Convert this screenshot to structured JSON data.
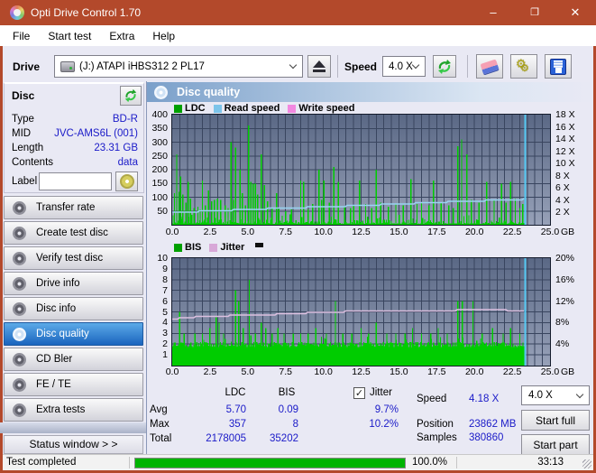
{
  "theme": {
    "titlebar": "#B3492B",
    "value_text": "#1A1AC8",
    "nav_selected": "#2F7FD0",
    "progress_green": "#00B400",
    "chart_bg_top": "#5A6885",
    "chart_bg_bottom": "#97A1B8"
  },
  "window": {
    "title": "Opti Drive Control 1.70",
    "controls": {
      "minimize": "–",
      "maximize": "❐",
      "close": "✕"
    }
  },
  "menu": {
    "items": [
      "File",
      "Start test",
      "Extra",
      "Help"
    ]
  },
  "toolbar": {
    "drive_label": "Drive",
    "drive_value": "(J:)   ATAPI iHBS312   2 PL17",
    "speed_label": "Speed",
    "speed_value": "4.0 X"
  },
  "disc_panel": {
    "title": "Disc",
    "fields": [
      {
        "label": "Type",
        "value": "BD-R"
      },
      {
        "label": "MID",
        "value": "JVC-AMS6L (001)"
      },
      {
        "label": "Length",
        "value": "23.31 GB"
      },
      {
        "label": "Contents",
        "value": "data"
      }
    ],
    "label_field": {
      "label": "Label",
      "value": ""
    }
  },
  "sidebar": {
    "items": [
      {
        "label": "Transfer rate",
        "selected": false
      },
      {
        "label": "Create test disc",
        "selected": false
      },
      {
        "label": "Verify test disc",
        "selected": false
      },
      {
        "label": "Drive info",
        "selected": false
      },
      {
        "label": "Disc info",
        "selected": false
      },
      {
        "label": "Disc quality",
        "selected": true
      },
      {
        "label": "CD Bler",
        "selected": false
      },
      {
        "label": "FE / TE",
        "selected": false
      },
      {
        "label": "Extra tests",
        "selected": false
      }
    ],
    "status_window_label": "Status window > >"
  },
  "main": {
    "header": "Disc quality"
  },
  "summary": {
    "col_headers": [
      "LDC",
      "BIS"
    ],
    "jitter_label": "Jitter",
    "jitter_checked": true,
    "rows": [
      {
        "label": "Avg",
        "ldc": "5.70",
        "bis": "0.09",
        "jitter": "9.7%"
      },
      {
        "label": "Max",
        "ldc": "357",
        "bis": "8",
        "jitter": "10.2%"
      },
      {
        "label": "Total",
        "ldc": "2178005",
        "bis": "35202",
        "jitter": ""
      }
    ],
    "info": [
      {
        "label": "Speed",
        "value": "4.18 X"
      },
      {
        "label": "Position",
        "value": "23862 MB"
      },
      {
        "label": "Samples",
        "value": "380860"
      }
    ],
    "speed_select": "4.0 X",
    "buttons": [
      "Start full",
      "Start part"
    ]
  },
  "statusbar": {
    "status": "Test completed",
    "progress_pct": "100.0%",
    "progress_value": 100,
    "elapsed": "33:13"
  },
  "chart_data": [
    {
      "type": "bar+line",
      "title": "LDC errors with read speed",
      "legend": [
        {
          "label": "LDC",
          "color": "#00A000"
        },
        {
          "label": "Read speed",
          "color": "#7CC4EA"
        },
        {
          "label": "Write speed",
          "color": "#F288E0"
        }
      ],
      "xlim": [
        0,
        25
      ],
      "x_unit": "GB",
      "x_ticks": [
        "0.0",
        "2.5",
        "5.0",
        "7.5",
        "10.0",
        "12.5",
        "15.0",
        "17.5",
        "20.0",
        "22.5",
        "25.0"
      ],
      "ylim_left": [
        0,
        400
      ],
      "y_ticks_left": [
        "400",
        "350",
        "300",
        "250",
        "200",
        "150",
        "100",
        "50"
      ],
      "ylim_right": [
        0,
        18
      ],
      "y_ticks_right": [
        "18 X",
        "16 X",
        "14 X",
        "12 X",
        "10 X",
        "8 X",
        "6 X",
        "4 X",
        "2 X"
      ],
      "bar_color": "#00CC00",
      "line_color": "#9AD4F2",
      "end_marker_color": "#55C8F2",
      "data_end_x": 23.35,
      "noise": {
        "max": 40,
        "base": 4,
        "step_gb": 0.065
      },
      "spikes": [
        [
          0.15,
          115
        ],
        [
          0.3,
          255
        ],
        [
          0.45,
          120
        ],
        [
          0.55,
          175
        ],
        [
          0.7,
          110
        ],
        [
          0.9,
          80
        ],
        [
          1.05,
          155
        ],
        [
          1.2,
          95
        ],
        [
          1.45,
          60
        ],
        [
          1.7,
          65
        ],
        [
          1.85,
          55
        ],
        [
          2.0,
          160
        ],
        [
          2.2,
          70
        ],
        [
          2.4,
          125
        ],
        [
          2.6,
          85
        ],
        [
          2.8,
          90
        ],
        [
          3.0,
          95
        ],
        [
          3.2,
          90
        ],
        [
          3.5,
          70
        ],
        [
          3.7,
          60
        ],
        [
          3.9,
          300
        ],
        [
          4.05,
          90
        ],
        [
          4.2,
          280
        ],
        [
          4.5,
          200
        ],
        [
          4.65,
          115
        ],
        [
          4.85,
          70
        ],
        [
          5.05,
          360
        ],
        [
          5.2,
          155
        ],
        [
          5.35,
          150
        ],
        [
          5.5,
          150
        ],
        [
          5.65,
          110
        ],
        [
          5.9,
          255
        ],
        [
          6.1,
          145
        ],
        [
          6.3,
          85
        ],
        [
          6.6,
          60
        ],
        [
          6.9,
          115
        ],
        [
          7.05,
          60
        ],
        [
          7.5,
          50
        ],
        [
          7.9,
          55
        ],
        [
          8.5,
          160
        ],
        [
          8.7,
          155
        ],
        [
          9.0,
          55
        ],
        [
          9.3,
          75
        ],
        [
          9.7,
          200
        ],
        [
          9.9,
          90
        ],
        [
          10.05,
          160
        ],
        [
          10.4,
          80
        ],
        [
          10.7,
          210
        ],
        [
          11.0,
          155
        ],
        [
          11.4,
          65
        ],
        [
          11.8,
          60
        ],
        [
          12.0,
          70
        ],
        [
          12.4,
          160
        ],
        [
          12.8,
          75
        ],
        [
          13.2,
          60
        ],
        [
          13.5,
          200
        ],
        [
          13.8,
          80
        ],
        [
          14.3,
          65
        ],
        [
          14.8,
          75
        ],
        [
          15.3,
          70
        ],
        [
          15.8,
          165
        ],
        [
          16.2,
          75
        ],
        [
          16.5,
          80
        ],
        [
          17.0,
          70
        ],
        [
          17.3,
          160
        ],
        [
          17.8,
          80
        ],
        [
          18.3,
          70
        ],
        [
          18.6,
          60
        ],
        [
          18.9,
          285
        ],
        [
          19.15,
          310
        ],
        [
          19.5,
          255
        ],
        [
          19.8,
          90
        ],
        [
          20.3,
          80
        ],
        [
          20.8,
          155
        ],
        [
          21.3,
          90
        ],
        [
          21.8,
          150
        ],
        [
          22.1,
          80
        ],
        [
          22.4,
          155
        ],
        [
          22.7,
          95
        ],
        [
          23.0,
          60
        ],
        [
          23.2,
          75
        ]
      ],
      "line_points_rightaxis": [
        [
          0,
          2.0
        ],
        [
          2,
          2.2
        ],
        [
          4,
          2.4
        ],
        [
          6,
          2.6
        ],
        [
          8,
          2.75
        ],
        [
          10,
          2.95
        ],
        [
          12,
          3.1
        ],
        [
          14,
          3.3
        ],
        [
          16,
          3.5
        ],
        [
          18,
          3.7
        ],
        [
          20,
          3.9
        ],
        [
          21.5,
          4.0
        ],
        [
          23.3,
          4.18
        ]
      ]
    },
    {
      "type": "bar+line",
      "title": "BIS errors with jitter",
      "legend": [
        {
          "label": "BIS",
          "color": "#00A000"
        },
        {
          "label": "Jitter",
          "color": "#D8A8D8"
        }
      ],
      "xlim": [
        0,
        25
      ],
      "x_unit": "GB",
      "x_ticks": [
        "0.0",
        "2.5",
        "5.0",
        "7.5",
        "10.0",
        "12.5",
        "15.0",
        "17.5",
        "20.0",
        "22.5",
        "25.0"
      ],
      "ylim_left": [
        0,
        10
      ],
      "y_ticks_left": [
        "10",
        "9",
        "8",
        "7",
        "6",
        "5",
        "4",
        "3",
        "2",
        "1"
      ],
      "ylim_right": [
        0,
        20
      ],
      "y_ticks_right": [
        "20%",
        "16%",
        "12%",
        "8%",
        "4%"
      ],
      "bar_color": "#00CC00",
      "line_color": "#DCC0E0",
      "end_marker_color": "#55C8F2",
      "data_end_x": 23.35,
      "noise": {
        "max": 2.2,
        "base": 1.7,
        "step_gb": 0.065
      },
      "spikes": [
        [
          0.5,
          5
        ],
        [
          0.8,
          3
        ],
        [
          1.5,
          3
        ],
        [
          2.0,
          3
        ],
        [
          2.5,
          3.5
        ],
        [
          2.9,
          4.5
        ],
        [
          3.1,
          4
        ],
        [
          3.4,
          3
        ],
        [
          4.2,
          7
        ],
        [
          4.4,
          6
        ],
        [
          4.7,
          3.5
        ],
        [
          5.1,
          8
        ],
        [
          5.5,
          3
        ],
        [
          5.9,
          4
        ],
        [
          6.2,
          3.5
        ],
        [
          6.6,
          3
        ],
        [
          7.0,
          3.5
        ],
        [
          7.4,
          3
        ],
        [
          8.0,
          3
        ],
        [
          8.5,
          3
        ],
        [
          9.0,
          3
        ],
        [
          9.5,
          3.5
        ],
        [
          10.2,
          3
        ],
        [
          10.8,
          6
        ],
        [
          11.3,
          3
        ],
        [
          11.9,
          3
        ],
        [
          12.5,
          3.5
        ],
        [
          13.0,
          3
        ],
        [
          13.5,
          4
        ],
        [
          14.2,
          3
        ],
        [
          14.8,
          3
        ],
        [
          15.4,
          3
        ],
        [
          15.9,
          3.5
        ],
        [
          16.5,
          3
        ],
        [
          17.1,
          3
        ],
        [
          17.6,
          3.5
        ],
        [
          18.2,
          3
        ],
        [
          18.9,
          6
        ],
        [
          19.2,
          6
        ],
        [
          19.9,
          6
        ],
        [
          20.5,
          3
        ],
        [
          21.2,
          3.5
        ],
        [
          21.9,
          3
        ],
        [
          22.4,
          3.5
        ],
        [
          23.0,
          3
        ]
      ],
      "line_points_rightaxis": [
        [
          0,
          8.7
        ],
        [
          1,
          8.9
        ],
        [
          2,
          9.2
        ],
        [
          4,
          9.3
        ],
        [
          6,
          9.4
        ],
        [
          8,
          9.7
        ],
        [
          10,
          9.9
        ],
        [
          12,
          10.1
        ],
        [
          13,
          10.2
        ],
        [
          16,
          10.2
        ],
        [
          19,
          10.3
        ],
        [
          22,
          10.3
        ],
        [
          23.3,
          10.2
        ]
      ]
    }
  ]
}
